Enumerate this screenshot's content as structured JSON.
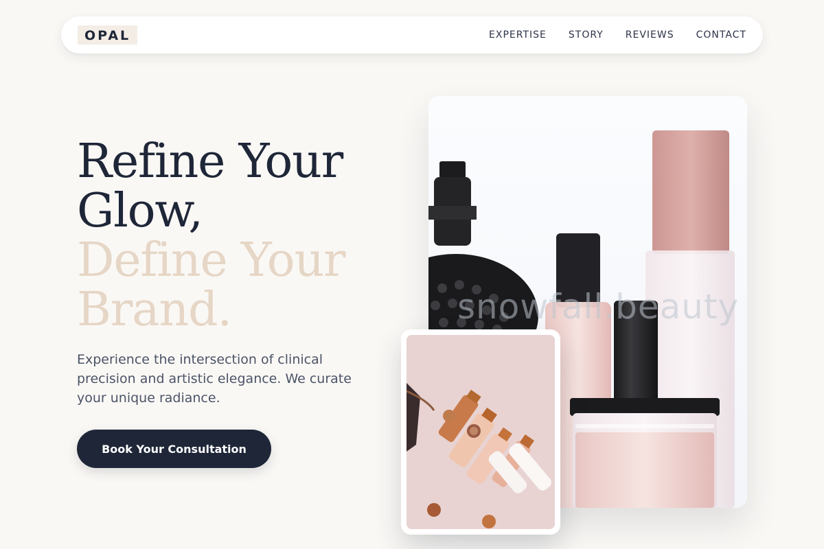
{
  "brand": {
    "logo": "OPAL"
  },
  "nav": {
    "links": [
      {
        "label": "EXPERTISE"
      },
      {
        "label": "STORY"
      },
      {
        "label": "REVIEWS"
      },
      {
        "label": "CONTACT"
      }
    ]
  },
  "hero": {
    "line1": "Refine Your",
    "line2": "Glow,",
    "line3": "Define Your",
    "line4": "Brand.",
    "subtext": "Experience the intersection of clinical precision and artistic elegance. We curate your unique radiance.",
    "cta_label": "Book Your Consultation"
  },
  "images": {
    "main_watermark": "snowfall.beauty"
  },
  "colors": {
    "navy": "#1e2638",
    "sand": "#e6d6c6",
    "background": "#faf8f5",
    "blush": "#e7d2d1"
  }
}
